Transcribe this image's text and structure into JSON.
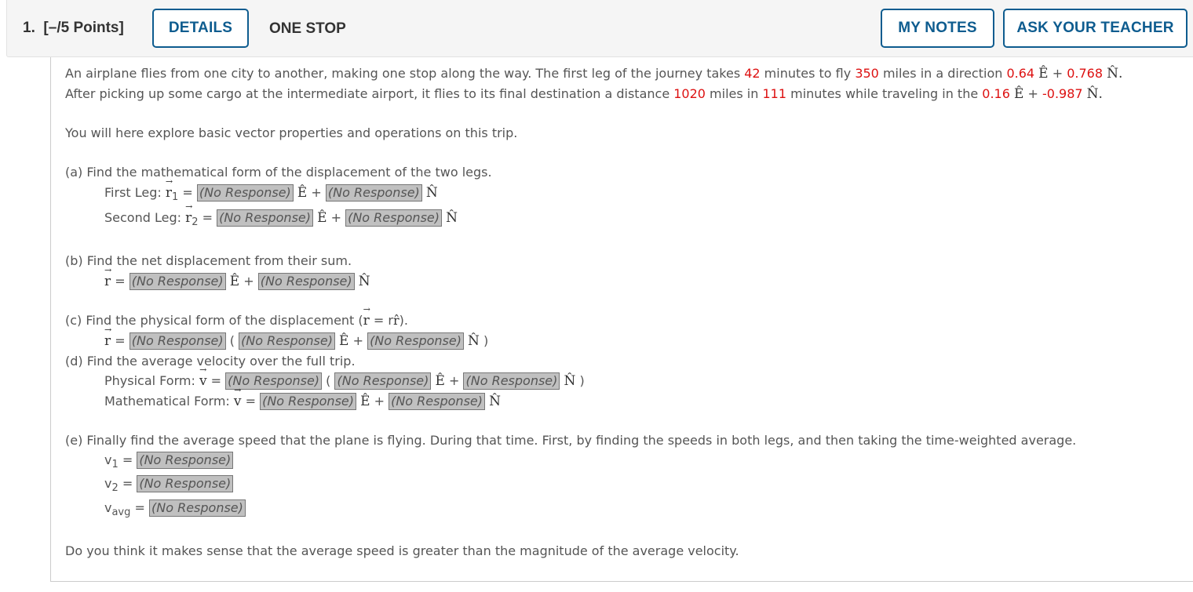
{
  "header": {
    "question_number": "1.",
    "points": "[–/5 Points]",
    "details_label": "DETAILS",
    "title": "ONE STOP",
    "my_notes_label": "MY NOTES",
    "ask_teacher_label": "ASK YOUR TEACHER"
  },
  "problem": {
    "p1_a": "An airplane flies from one city to another, making one stop along the way. The first leg of the journey takes ",
    "t1": "42",
    "p1_b": " minutes to fly ",
    "d1": "350",
    "p1_c": " miles in a direction ",
    "e1": "0.64",
    "n1": "0.768",
    "p2_a": "After picking up some cargo at the intermediate airport, it flies to its final destination a distance ",
    "d2": "1020",
    "p2_b": " miles in ",
    "t2": "111",
    "p2_c": " minutes while traveling in the ",
    "e2": "0.16",
    "n2": "-0.987",
    "intro": "You will here explore basic vector properties and operations on this trip."
  },
  "symbols": {
    "E": "Ê",
    "N": "N̂",
    "plus": "+",
    "eq": "=",
    "r": "r",
    "v": "v",
    "arrow": "→",
    "open_paren": "(",
    "close_paren": ")",
    "period": "."
  },
  "parts": {
    "a": {
      "prompt": "(a) Find the mathematical form of the displacement of the two legs.",
      "first_label": "First Leg: ",
      "first_sub": "1",
      "second_label": "Second Leg: ",
      "second_sub": "2"
    },
    "b": {
      "prompt": "(b) Find the net displacement from their sum."
    },
    "c": {
      "prompt_a": "(c) Find the physical form of the displacement (",
      "prompt_b": " = r",
      "rhat": "r̂",
      "prompt_c": ")."
    },
    "d": {
      "prompt": "(d) Find the average velocity over the full trip.",
      "physical_label": "Physical Form: ",
      "math_label": "Mathematical Form: "
    },
    "e": {
      "prompt": "(e) Finally find the average speed that the plane is flying. During that time. First, by finding the speeds in both legs, and then taking the time-weighted average.",
      "v1_sub": "1",
      "v2_sub": "2",
      "vavg_sub": "avg"
    },
    "final": "Do you think it makes sense that the average speed is greater than the magnitude of the average velocity."
  },
  "responses": {
    "placeholder": "(No Response)"
  }
}
